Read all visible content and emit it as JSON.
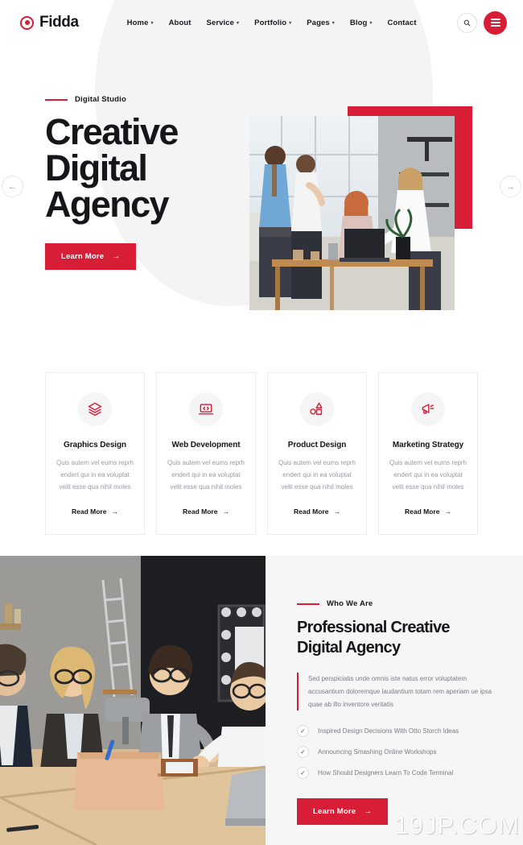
{
  "header": {
    "logo_text": "Fidda",
    "nav": [
      {
        "label": "Home",
        "has_dropdown": true
      },
      {
        "label": "About",
        "has_dropdown": false
      },
      {
        "label": "Service",
        "has_dropdown": true
      },
      {
        "label": "Portfolio",
        "has_dropdown": true
      },
      {
        "label": "Pages",
        "has_dropdown": true
      },
      {
        "label": "Blog",
        "has_dropdown": true
      },
      {
        "label": "Contact",
        "has_dropdown": false
      }
    ],
    "search_icon": "search-icon",
    "menu_icon": "hamburger-menu-icon"
  },
  "slider": {
    "prev_label": "←",
    "next_label": "→"
  },
  "hero": {
    "eyebrow": "Digital Studio",
    "title_line1": "Creative",
    "title_line2": "Digital",
    "title_line3": "Agency",
    "cta_label": "Learn More",
    "cta_arrow": "→"
  },
  "services": [
    {
      "icon": "layers-icon",
      "title": "Graphics Design",
      "desc": "Quis autem vel eums reprh endert qui in ea voluptat velit esse qua nihil moles",
      "link_label": "Read More",
      "link_arrow": "→"
    },
    {
      "icon": "laptop-code-icon",
      "title": "Web Development",
      "desc": "Quis autem vel eums reprh endert qui in ea voluptat velit esse qua nihil moles",
      "link_label": "Read More",
      "link_arrow": "→"
    },
    {
      "icon": "shapes-icon",
      "title": "Product Design",
      "desc": "Quis autem vel eums reprh endert qui in ea voluptat velit esse qua nihil moles",
      "link_label": "Read More",
      "link_arrow": "→"
    },
    {
      "icon": "megaphone-icon",
      "title": "Marketing Strategy",
      "desc": "Quis autem vel eums reprh endert qui in ea voluptat velit esse qua nihil moles",
      "link_label": "Read More",
      "link_arrow": "→"
    }
  ],
  "about": {
    "eyebrow": "Who We Are",
    "title_line1": "Professional Creative",
    "title_line2": "Digital Agency",
    "quote": "Sed perspiciatis unde omnis iste natus error voluptatem accusantium doloremque laudantium totam rem aperiam ue ipsa quae ab illo inventore veritatis",
    "checks": [
      "Inspired Design Decisions With Otto Storch Ideas",
      "Announcing Smashing Online Workshops",
      "How Should Designers Learn To Code Terminal"
    ],
    "cta_label": "Learn More",
    "cta_arrow": "→"
  },
  "watermark": "19JP.COM",
  "colors": {
    "accent": "#d81e36",
    "dark": "#16161a",
    "muted": "#9a9aa2",
    "section_bg": "#f6f6f7"
  }
}
